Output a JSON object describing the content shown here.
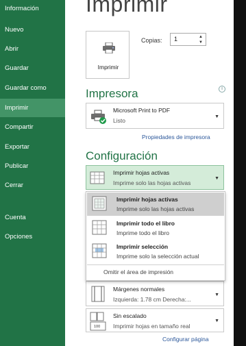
{
  "sidebar": {
    "items": [
      {
        "label": "Información",
        "active": false
      },
      {
        "label": "Nuevo",
        "active": false
      },
      {
        "label": "Abrir",
        "active": false
      },
      {
        "label": "Guardar",
        "active": false
      },
      {
        "label": "Guardar como",
        "active": false
      },
      {
        "label": "Imprimir",
        "active": true
      },
      {
        "label": "Compartir",
        "active": false
      },
      {
        "label": "Exportar",
        "active": false
      },
      {
        "label": "Publicar",
        "active": false
      },
      {
        "label": "Cerrar",
        "active": false
      },
      {
        "label": "Cuenta",
        "active": false
      },
      {
        "label": "Opciones",
        "active": false
      }
    ]
  },
  "main": {
    "title": "Imprimir",
    "print_button_label": "Imprimir",
    "copies_label": "Copias:",
    "copies_value": "1"
  },
  "printer": {
    "heading": "Impresora",
    "name": "Microsoft Print to PDF",
    "status": "Listo",
    "properties_link": "Propiedades de impresora"
  },
  "config": {
    "heading": "Configuración",
    "scope_selected": {
      "title": "Imprimir hojas activas",
      "subtitle": "Imprime solo las hojas activas"
    },
    "scope_options": [
      {
        "title": "Imprimir hojas activas",
        "subtitle": "Imprime solo las hojas activas",
        "selected": true
      },
      {
        "title": "Imprimir todo el libro",
        "subtitle": "Imprime todo el libro",
        "selected": false
      },
      {
        "title": "Imprimir selección",
        "subtitle": "Imprime solo la selección actual",
        "selected": false
      }
    ],
    "omit_print_area": "Omitir el área de impresión",
    "margins": {
      "title": "Márgenes normales",
      "subtitle": "Izquierda:  1.78 cm    Derecha:..."
    },
    "scaling": {
      "title": "Sin escalado",
      "subtitle": "Imprimir hojas en tamaño real",
      "icon_text": "100"
    },
    "page_setup_link": "Configurar página"
  },
  "colors": {
    "sidebar": "#217346",
    "sidebar_active": "#439467",
    "heading": "#217346",
    "link": "#2b579a",
    "selected_option": "#cfcfcf"
  }
}
